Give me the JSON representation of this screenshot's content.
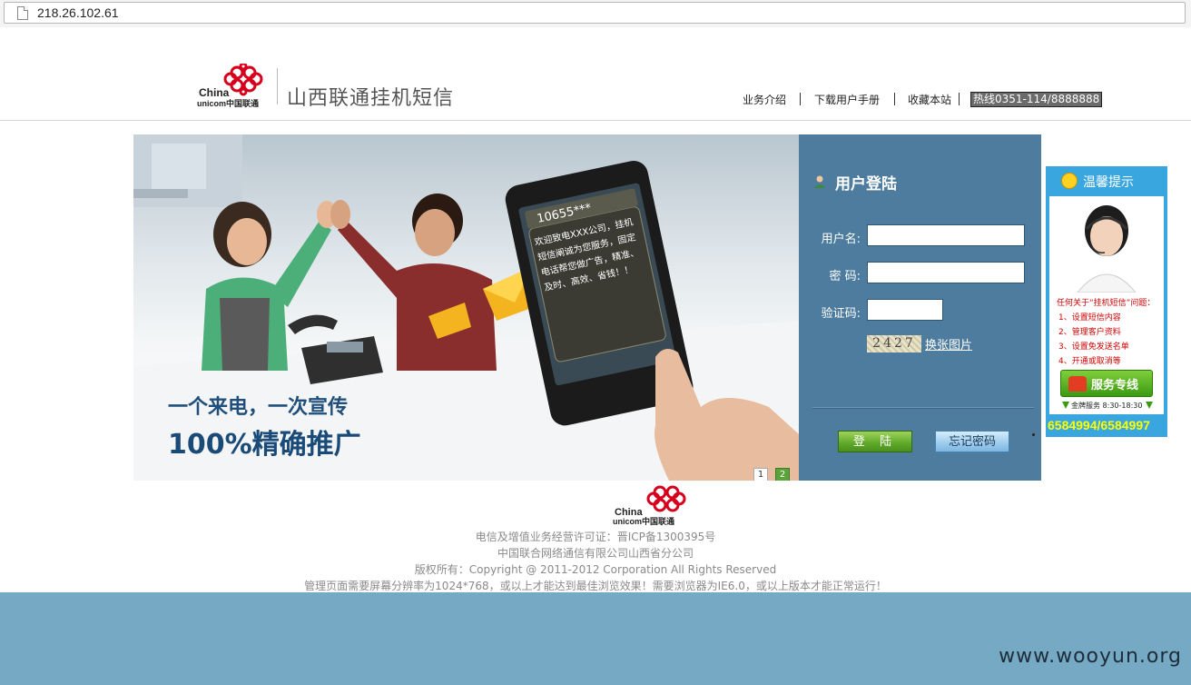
{
  "browser": {
    "url": "218.26.102.61"
  },
  "header": {
    "logo_text_top": "China",
    "logo_text_bottom": "unicom中国联通",
    "site_title": "山西联通挂机短信",
    "nav": [
      "业务介绍",
      "下载用户手册",
      "收藏本站"
    ],
    "hotline": "热线0351-114/8888888"
  },
  "banner": {
    "slogan_line1": "一个来电，一次宣传",
    "slogan_line2": "100%精确推广",
    "phone_number": "10655***",
    "phone_message": "欢迎致电XXX公司，挂机短信阐诚为您服务，固定电话帮您做广告，精准、及时、高效、省钱！！",
    "slides": [
      "1",
      "2"
    ]
  },
  "login": {
    "title": "用户登陆",
    "username_label": "用户名:",
    "password_label": "密  码:",
    "captcha_label": "验证码:",
    "captcha_value": "2427",
    "captcha_refresh": "换张图片",
    "login_button": "登 陆",
    "forgot_button": "忘记密码"
  },
  "tips": {
    "title": "温馨提示",
    "question": "任何关于“挂机短信”问题：",
    "items": [
      "1、设置短信内容",
      "2、管理客户资料",
      "3、设置免发送名单",
      "4、开通或取消等"
    ],
    "service_button": "服务专线",
    "service_hours": "金牌服务 8:30-18:30",
    "phones": "6584994/6584997"
  },
  "footer": {
    "logo_text_top": "China",
    "logo_text_bottom": "unicom中国联通",
    "license": "电信及增值业务经营许可证：晋ICP备1300395号",
    "company": "中国联合网络通信有限公司山西省分公司",
    "copyright": "版权所有：Copyright @ 2011-2012 Corporation All Rights Reserved",
    "notice": "管理页面需要屏幕分辨率为1024*768，或以上才能达到最佳浏览效果！需要浏览器为IE6.0，或以上版本才能正常运行！"
  },
  "watermark": "www.wooyun.org",
  "colors": {
    "unicom_red": "#d6001c",
    "login_panel": "#4d7c9e",
    "tip_panel": "#3aa6df",
    "bottom_band": "#75a9c4"
  }
}
